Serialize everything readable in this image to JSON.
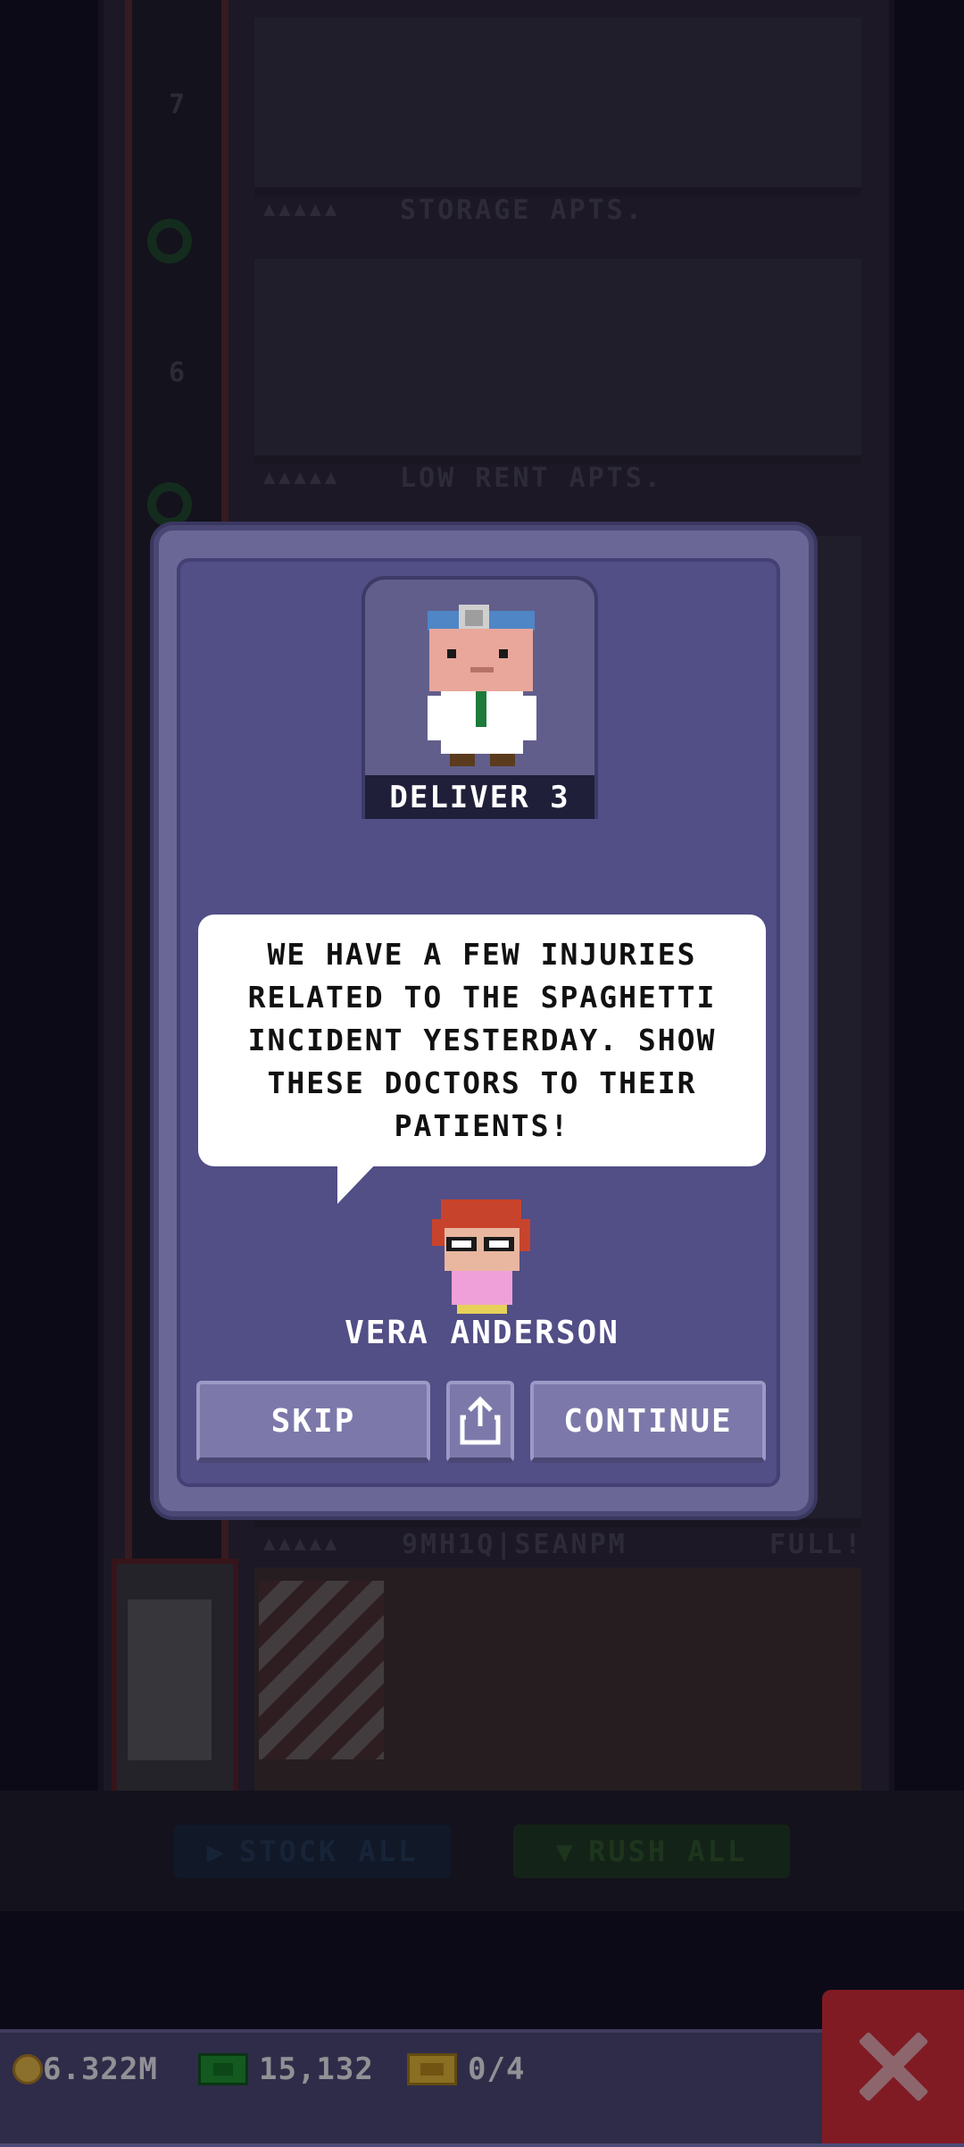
{
  "tower": {
    "floors": [
      {
        "name": "STORAGE APTS.",
        "stars": "▲▲▲▲▲"
      },
      {
        "name": "LOW RENT APTS.",
        "stars": "▲▲▲▲▲"
      },
      {
        "name": "9MH1Q|SEANPM",
        "stars": "▲▲▲▲▲",
        "status": "FULL!"
      }
    ],
    "elevator_floor_numbers": [
      "7",
      "6"
    ]
  },
  "shop": {
    "stock_all": "STOCK ALL",
    "rush_all": "RUSH ALL"
  },
  "mission": {
    "portrait_label": "DELIVER 3",
    "message": "WE HAVE A FEW INJURIES RELATED TO THE SPAGHETTI INCIDENT YESTERDAY. SHOW THESE DOCTORS TO THEIR PATIENTS!",
    "speaker": "VERA ANDERSON",
    "skip": "SKIP",
    "continue": "CONTINUE",
    "share_icon": "share-icon"
  },
  "status": {
    "coins": "6.322M",
    "bux": "15,132",
    "tickets": "0/4"
  },
  "colors": {
    "close_button": "#e02a32",
    "dialog": "#524e86",
    "status_bar": "#4d4a76"
  }
}
